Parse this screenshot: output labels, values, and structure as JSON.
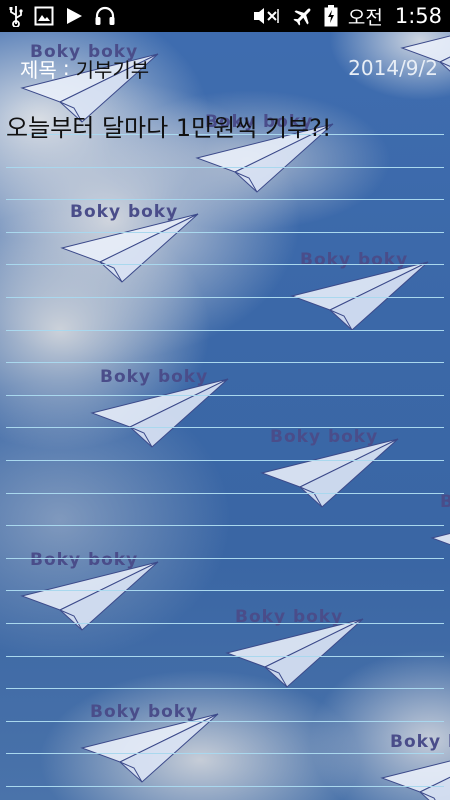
{
  "status_bar": {
    "icons_left": [
      "usb-icon",
      "image-icon",
      "play-icon",
      "headset-icon"
    ],
    "icons_right": [
      "mute-icon",
      "airplane-mode-icon",
      "battery-charging-icon"
    ],
    "ampm": "오전",
    "time": "1:58"
  },
  "memo": {
    "title_label": "제목",
    "title_separator": ":",
    "title_value": "기부기부",
    "date": "2014/9/2",
    "body": "오늘부터 달마다 1만원씩 기부?!"
  },
  "background": {
    "watermark_text": "Boky boky",
    "line_color": "#a9d8ee",
    "sky_color": "#3f6db0"
  }
}
